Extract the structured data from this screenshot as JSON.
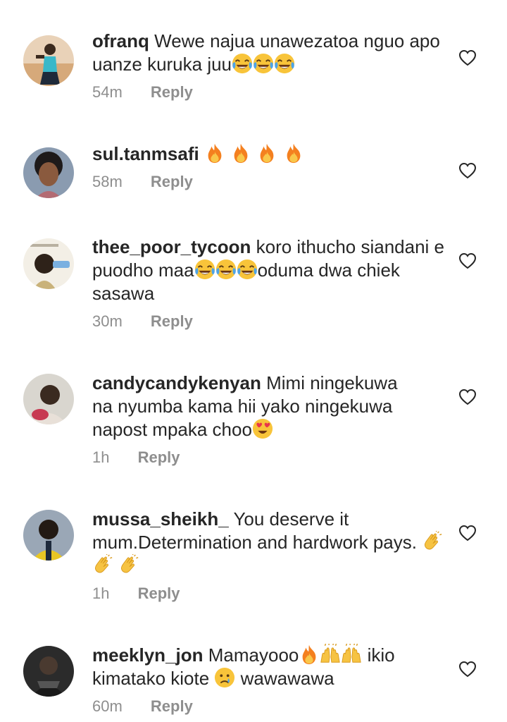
{
  "reply_label": "Reply",
  "comments": [
    {
      "username": "ofranq",
      "text_parts": [
        "Wewe najua unawezatoa nguo apo uanze kuruka juu"
      ],
      "emojis_after": [
        "joy-emoji",
        "joy-emoji",
        "joy-emoji"
      ],
      "time": "54m"
    },
    {
      "username": "sul.tanmsafi",
      "text_parts": [
        ""
      ],
      "emojis_after": [
        "fire-emoji",
        "fire-emoji",
        "fire-emoji",
        "fire-emoji"
      ],
      "time": "58m"
    },
    {
      "username": "thee_poor_tycoon",
      "text_parts": [
        "koro ithucho siandani e puodho maa",
        "oduma dwa chiek sasawa"
      ],
      "emojis_between": [
        "joy-emoji",
        "joy-emoji",
        "joy-emoji"
      ],
      "time": "30m"
    },
    {
      "username": "candycandykenyan",
      "text_parts": [
        "Mimi ningekuwa na nyumba kama hii yako ningekuwa napost mpaka choo"
      ],
      "emojis_after": [
        "heart-eyes-emoji"
      ],
      "time": "1h"
    },
    {
      "username": "mussa_sheikh_",
      "text_parts": [
        "You deserve it mum.Determination and hardwork pays."
      ],
      "emojis_after": [
        "clap-emoji",
        "clap-emoji",
        "clap-emoji"
      ],
      "time": "1h"
    },
    {
      "username": "meeklyn_jon",
      "text_parts": [
        "Mamayooo",
        " ikio kimatako kiote ",
        " wawawawa"
      ],
      "emojis_mixed": [
        [
          "fire-emoji",
          "raised-hands-emoji",
          "raised-hands-emoji"
        ],
        [
          "crying-emoji"
        ]
      ],
      "time": "60m"
    }
  ],
  "colors": {
    "text": "#262626",
    "muted": "#8e8e8e",
    "background": "#ffffff"
  }
}
